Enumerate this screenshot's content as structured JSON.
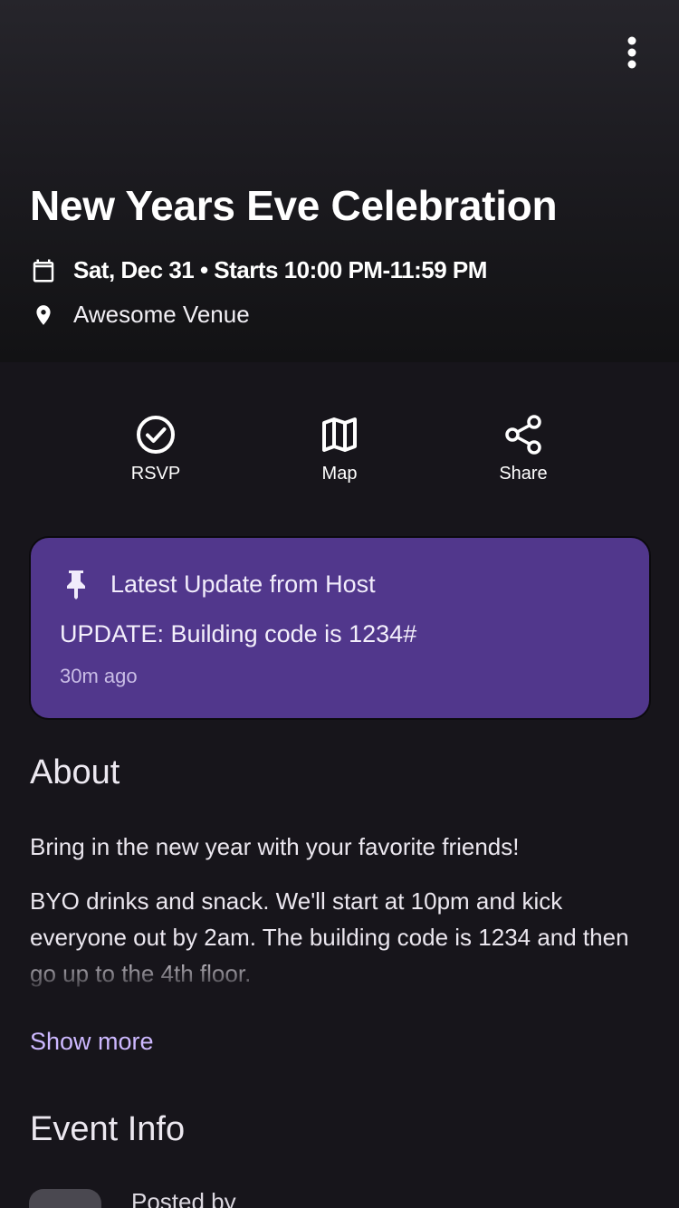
{
  "header": {
    "title": "New Years Eve Celebration",
    "date_text": "Sat, Dec 31 • Starts 10:00 PM-11:59 PM",
    "venue": "Awesome Venue",
    "icons": {
      "menu": "more-vertical-icon",
      "date": "calendar-icon",
      "venue": "location-pin-icon"
    }
  },
  "actions": [
    {
      "label": "RSVP",
      "icon": "check-circle-icon"
    },
    {
      "label": "Map",
      "icon": "map-icon"
    },
    {
      "label": "Share",
      "icon": "share-icon"
    }
  ],
  "update": {
    "heading": "Latest Update from Host",
    "message": "UPDATE: Building code is 1234#",
    "time": "30m ago",
    "icon": "pin-icon",
    "color": "#51378c"
  },
  "about": {
    "title": "About",
    "paragraph1": "Bring in the new year with your favorite friends!",
    "paragraph2": "BYO drinks and snack. We'll start at 10pm and kick everyone out by 2am. The building code is 1234 and then go up to the 4th floor.",
    "show_more": "Show more"
  },
  "event_info": {
    "title": "Event Info",
    "posted_by": "Posted by"
  },
  "colors": {
    "background": "#17151b",
    "accent": "#cdb8ff",
    "card": "#51378c"
  }
}
